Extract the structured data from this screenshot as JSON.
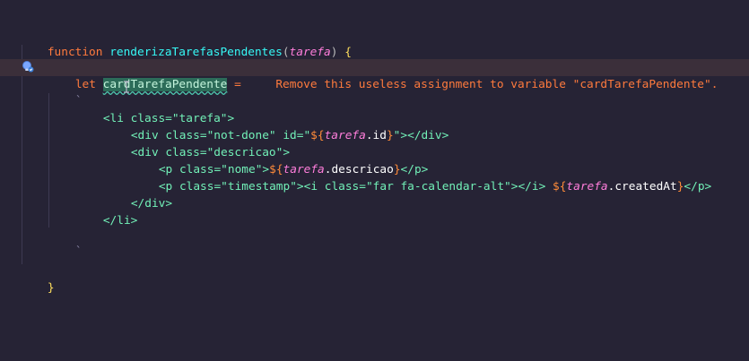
{
  "code": {
    "l1": {
      "kw": "function",
      "name": "renderizaTarefasPendentes",
      "open": "(",
      "param": "tarefa",
      "close": ")",
      "brace": " {"
    },
    "l2": {
      "kw": "let",
      "var": "cardTarefaPendente",
      "eq": "=",
      "diag": "Remove this useless assignment to variable \"cardTarefaPendente\"."
    },
    "l3": {
      "tick": "`"
    },
    "l4": {
      "text": "<li class=\"tarefa\">"
    },
    "l5": {
      "open": "<div class=\"not-done\" id=\"",
      "i_open": "${",
      "i_var": "tarefa",
      "i_prop": ".id",
      "i_close": "}",
      "close": "\"></div>"
    },
    "l6": {
      "text": "<div class=\"descricao\">"
    },
    "l7": {
      "open": "<p class=\"nome\">",
      "i_open": "${",
      "i_var": "tarefa",
      "i_prop": ".descricao",
      "i_close": "}",
      "close": "</p>"
    },
    "l8": {
      "open": "<p class=\"timestamp\"><i class=\"far fa-calendar-alt\"></i> ",
      "i_open": "${",
      "i_var": "tarefa",
      "i_prop": ".createdAt",
      "i_close": "}",
      "close": "</p>"
    },
    "l9": {
      "text": "</div>"
    },
    "l10": {
      "text": "</li>"
    },
    "l11": {
      "tick": "`"
    },
    "l12": {
      "text": "}"
    }
  },
  "icons": {
    "quickfix": "lightbulb-icon",
    "cursor": "ibeam-cursor-icon"
  },
  "colors": {
    "background": "#262335",
    "warning": "#fe7a3d",
    "function_keyword": "#fede5d",
    "function_name": "#36f9f6",
    "parameter": "#ff7edb",
    "tag": "#72f1b8",
    "string": "#ff8b39"
  }
}
